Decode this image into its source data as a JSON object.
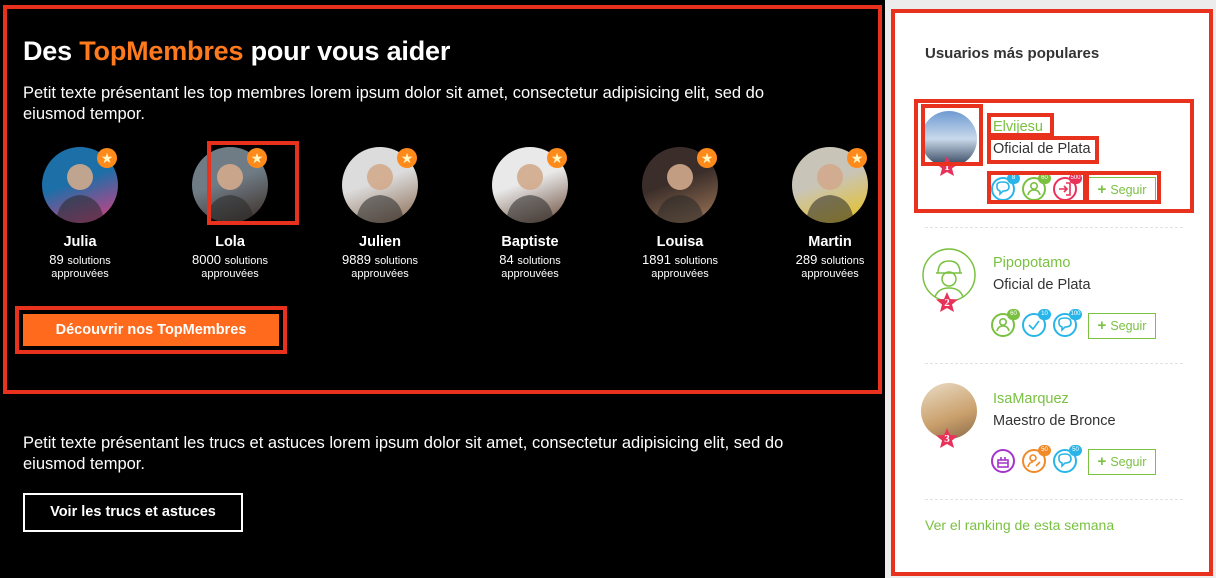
{
  "hero": {
    "title_prefix": "Des",
    "title_highlight": "TopMembres",
    "title_suffix": "pour vous aider",
    "intro": "Petit texte présentant les top membres lorem ipsum dolor sit amet, consectetur adipisicing elit, sed do eiusmod tempor.",
    "members": [
      {
        "name": "Julia",
        "count": "89",
        "unit": "solutions",
        "approved": "approuvées",
        "colors": [
          "#1d6fa8",
          "#e03a7c"
        ]
      },
      {
        "name": "Lola",
        "count": "8000",
        "unit": "solutions",
        "approved": "approuvées",
        "colors": [
          "#6f7c86",
          "#3b2a22"
        ]
      },
      {
        "name": "Julien",
        "count": "9889",
        "unit": "solutions",
        "approved": "approuvées",
        "colors": [
          "#dcdcdc",
          "#8a6a52"
        ]
      },
      {
        "name": "Baptiste",
        "count": "84",
        "unit": "solutions",
        "approved": "approuvées",
        "colors": [
          "#e9e9e9",
          "#6a4b3a"
        ]
      },
      {
        "name": "Louisa",
        "count": "1891",
        "unit": "solutions",
        "approved": "approuvées",
        "colors": [
          "#3b2e2a",
          "#a07858"
        ]
      },
      {
        "name": "Martin",
        "count": "289",
        "unit": "solutions",
        "approved": "approuvées",
        "colors": [
          "#c9c4b8",
          "#e8c21a"
        ]
      }
    ],
    "cta_label": "Découvrir nos TopMembres"
  },
  "tips": {
    "intro": "Petit texte présentant les trucs et astuces lorem ipsum dolor sit amet, consectetur adipisicing elit, sed do eiusmod tempor.",
    "button_label": "Voir les trucs et astuces"
  },
  "sidebar": {
    "title": "Usuarios más populares",
    "users": [
      {
        "name": "Elvijesu",
        "role": "Oficial de Plata",
        "rank": "1",
        "badges": [
          {
            "icon": "chat-icon",
            "color": "#29b5e8",
            "count": "8"
          },
          {
            "icon": "user-icon",
            "color": "#7ac142",
            "count": "60"
          },
          {
            "icon": "login-icon",
            "color": "#e8325a",
            "count": "500"
          }
        ]
      },
      {
        "name": "Pipopotamo",
        "role": "Oficial de Plata",
        "rank": "2",
        "badges": [
          {
            "icon": "user-icon",
            "color": "#7ac142",
            "count": "60"
          },
          {
            "icon": "check-icon",
            "color": "#29b5e8",
            "count": "10"
          },
          {
            "icon": "chat-icon",
            "color": "#29b5e8",
            "count": "100"
          }
        ]
      },
      {
        "name": "IsaMarquez",
        "role": "Maestro de Bronce",
        "rank": "3",
        "badges": [
          {
            "icon": "cake-icon",
            "color": "#a435c9",
            "count": ""
          },
          {
            "icon": "user-edit-icon",
            "color": "#f08a2a",
            "count": "50"
          },
          {
            "icon": "chat-icon",
            "color": "#29b5e8",
            "count": "50"
          }
        ]
      }
    ],
    "follow_label": "Seguir",
    "ranking_link": "Ver el ranking de esta semana"
  }
}
